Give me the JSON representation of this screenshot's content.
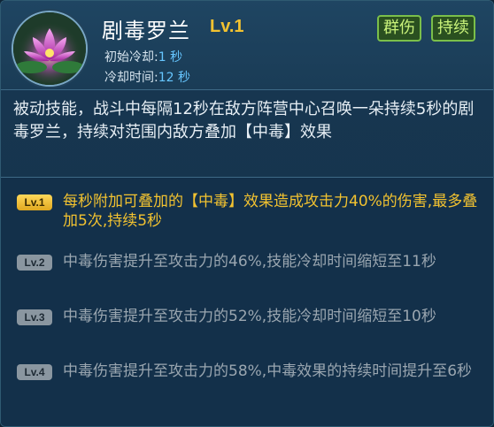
{
  "skill": {
    "name": "剧毒罗兰",
    "level": "Lv.1",
    "tags": [
      "群伤",
      "持续"
    ],
    "initial_cd_label": "初始冷却:",
    "initial_cd_value": "1 秒",
    "cd_label": "冷却时间:",
    "cd_value": "12 秒",
    "icon": "purple-lotus-icon",
    "description": "被动技能，战斗中每隔12秒在敌方阵营中心召唤一朵持续5秒的剧毒罗兰，持续对范围内敌方叠加【中毒】效果"
  },
  "levels": [
    {
      "badge": "Lv.1",
      "text": "每秒附加可叠加的【中毒】效果造成攻击力40%的伤害,最多叠加5次,持续5秒",
      "active": true
    },
    {
      "badge": "Lv.2",
      "text": "中毒伤害提升至攻击力的46%,技能冷却时间缩短至11秒",
      "active": false
    },
    {
      "badge": "Lv.3",
      "text": "中毒伤害提升至攻击力的52%,技能冷却时间缩短至10秒",
      "active": false
    },
    {
      "badge": "Lv.4",
      "text": "中毒伤害提升至攻击力的58%,中毒效果的持续时间提升至6秒",
      "active": false
    }
  ],
  "colors": {
    "gold": "#f2c230",
    "tag_green": "#7bbf4a",
    "cd_blue": "#66c6ff",
    "inactive_gray": "#9aa6b0"
  }
}
